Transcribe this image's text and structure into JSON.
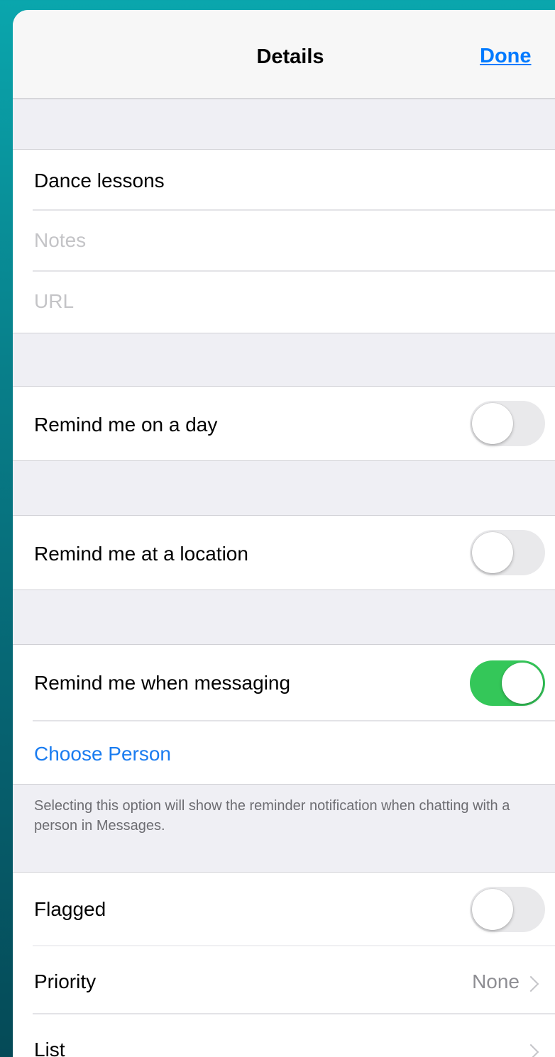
{
  "navbar": {
    "title": "Details",
    "done_label": "Done"
  },
  "details": {
    "title_value": "Dance lessons",
    "notes_placeholder": "Notes",
    "url_placeholder": "URL"
  },
  "reminders": {
    "day_label": "Remind me on a day",
    "day_on": false,
    "location_label": "Remind me at a location",
    "location_on": false,
    "messaging_label": "Remind me when messaging",
    "messaging_on": true,
    "choose_person_label": "Choose Person",
    "messaging_footnote": "Selecting this option will show the reminder notification when chatting with a person in Messages."
  },
  "options": {
    "flagged_label": "Flagged",
    "flagged_on": false,
    "priority_label": "Priority",
    "priority_value": "None",
    "list_label": "List"
  },
  "colors": {
    "accent": "#007aff",
    "toggle_on": "#34c759",
    "background": "#0a9aa3"
  }
}
